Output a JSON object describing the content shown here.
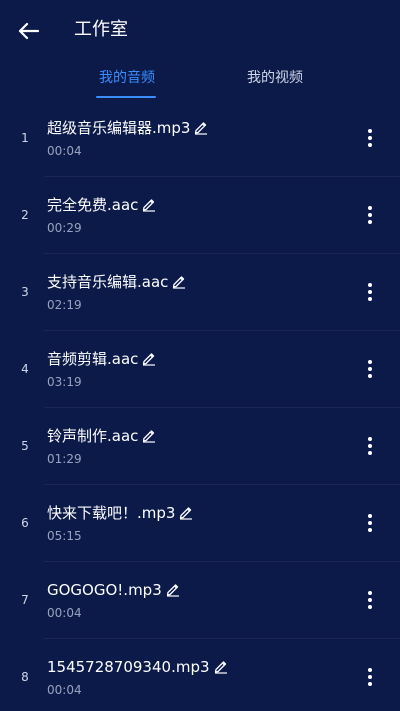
{
  "header": {
    "back_icon": "arrow-left-icon",
    "title": "工作室"
  },
  "tabs": [
    {
      "label": "我的音频",
      "active": true
    },
    {
      "label": "我的视频",
      "active": false
    }
  ],
  "colors": {
    "background": "#0c1a4a",
    "accent": "#3a8cff"
  },
  "items": [
    {
      "index": "1",
      "name": "超级音乐编辑器.mp3",
      "duration": "00:04"
    },
    {
      "index": "2",
      "name": "完全免费.aac",
      "duration": "00:29"
    },
    {
      "index": "3",
      "name": "支持音乐编辑.aac",
      "duration": "02:19"
    },
    {
      "index": "4",
      "name": "音频剪辑.aac",
      "duration": "03:19"
    },
    {
      "index": "5",
      "name": "铃声制作.aac",
      "duration": "01:29"
    },
    {
      "index": "6",
      "name": "快来下载吧！.mp3",
      "duration": "05:15"
    },
    {
      "index": "7",
      "name": "GOGOGO!.mp3",
      "duration": "00:04"
    },
    {
      "index": "8",
      "name": "1545728709340.mp3",
      "duration": "00:04"
    }
  ]
}
